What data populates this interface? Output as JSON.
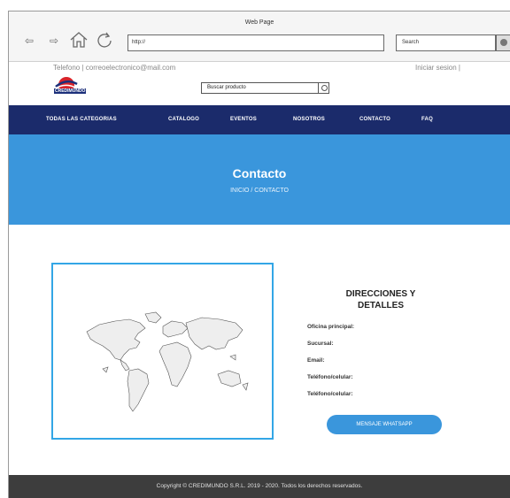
{
  "browser": {
    "title": "Web Page",
    "url": "http://",
    "search_placeholder": "Search"
  },
  "topinfo": {
    "contact": "Telefono | correoelectronico@mail.com",
    "login": "Iniciar sesion |"
  },
  "logo": {
    "text": "CREDIMUNDO"
  },
  "product_search": {
    "placeholder": "Buscar producto"
  },
  "nav": {
    "items": [
      "TODAS LAS CATEGORIAS",
      "CATALOGO",
      "EVENTOS",
      "NOSOTROS",
      "CONTACTO",
      "FAQ"
    ]
  },
  "hero": {
    "title": "Contacto",
    "breadcrumb": "INICIO / CONTACTO"
  },
  "details": {
    "title_line1": "DIRECCIONES Y",
    "title_line2": "DETALLES",
    "labels": [
      "Oficina principal:",
      "Sucursal:",
      "Email:",
      "Teléfono/celular:",
      "Teléfono/celular:"
    ],
    "whatsapp_label": "MENSAJE WHATSAPP"
  },
  "footer": {
    "text": "Copyright © CREDIMUNDO S.R.L. 2019 - 2020. Todos los derechos reservados."
  },
  "colors": {
    "nav_bg": "#1b2b6b",
    "hero_bg": "#3a96dc",
    "map_border": "#33a6e6",
    "footer_bg": "#3d3d3d",
    "logo_red": "#d8232a"
  }
}
